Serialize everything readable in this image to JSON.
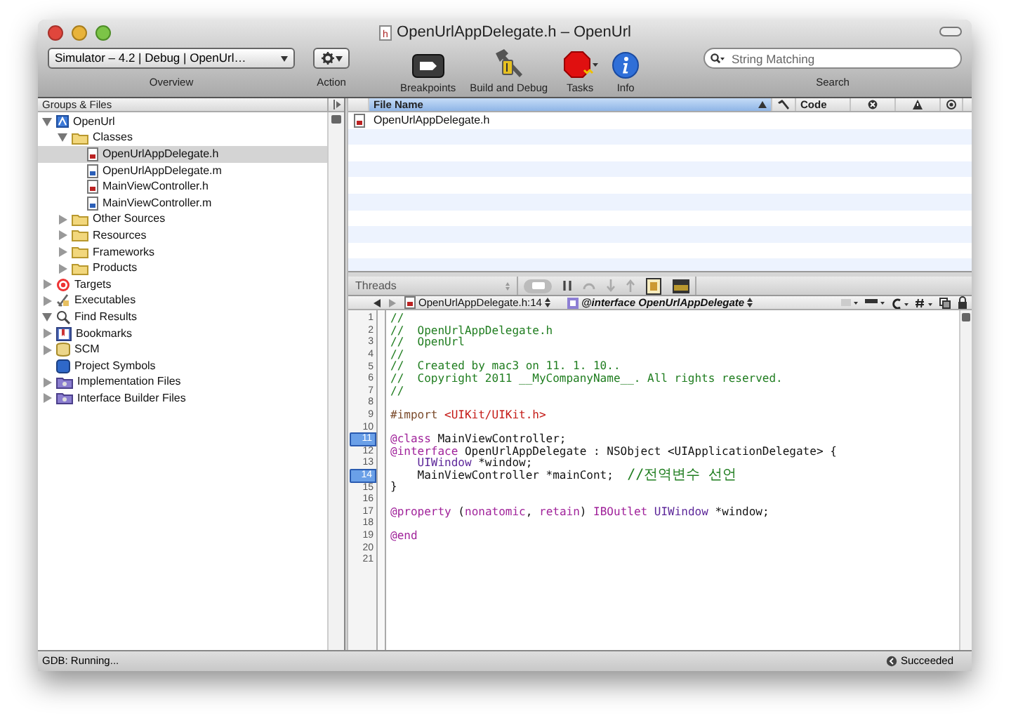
{
  "window": {
    "title": "OpenUrlAppDelegate.h – OpenUrl",
    "file_icon_letter": "h"
  },
  "toolbar": {
    "scheme": "Simulator – 4.2 | Debug | OpenUrl…",
    "scheme_label": "Overview",
    "action_label": "Action",
    "buttons": [
      {
        "kind": "breakpoints",
        "label": "Breakpoints"
      },
      {
        "kind": "build",
        "label": "Build and Debug"
      },
      {
        "kind": "tasks",
        "label": "Tasks"
      },
      {
        "kind": "info",
        "label": "Info"
      }
    ],
    "search": {
      "placeholder": "String Matching",
      "label": "Search"
    }
  },
  "sidebar": {
    "title": "Groups & Files",
    "items": [
      {
        "label": "OpenUrl",
        "kind": "project",
        "expanded": true,
        "selected": false,
        "children": [
          {
            "label": "Classes",
            "kind": "folder",
            "expanded": true,
            "selected": false,
            "children": [
              {
                "label": "OpenUrlAppDelegate.h",
                "kind": "file_h",
                "selected": true
              },
              {
                "label": "OpenUrlAppDelegate.m",
                "kind": "file_m",
                "selected": false
              },
              {
                "label": "MainViewController.h",
                "kind": "file_h",
                "selected": false
              },
              {
                "label": "MainViewController.m",
                "kind": "file_m",
                "selected": false
              }
            ]
          },
          {
            "label": "Other Sources",
            "kind": "folder",
            "expanded": false,
            "selected": false
          },
          {
            "label": "Resources",
            "kind": "folder",
            "expanded": false,
            "selected": false
          },
          {
            "label": "Frameworks",
            "kind": "folder",
            "expanded": false,
            "selected": false
          },
          {
            "label": "Products",
            "kind": "folder",
            "expanded": false,
            "selected": false
          }
        ]
      },
      {
        "label": "Targets",
        "kind": "target",
        "expanded": false,
        "selected": false
      },
      {
        "label": "Executables",
        "kind": "executables",
        "expanded": false,
        "selected": false
      },
      {
        "label": "Find Results",
        "kind": "find",
        "expanded": true,
        "selected": false
      },
      {
        "label": "Bookmarks",
        "kind": "bookmarks",
        "expanded": false,
        "selected": false
      },
      {
        "label": "SCM",
        "kind": "scm",
        "expanded": false,
        "selected": false
      },
      {
        "label": "Project Symbols",
        "kind": "symbols",
        "selected": false
      },
      {
        "label": "Implementation Files",
        "kind": "smartgroup",
        "expanded": false,
        "selected": false
      },
      {
        "label": "Interface Builder Files",
        "kind": "smartgroup",
        "expanded": false,
        "selected": false
      }
    ]
  },
  "file_table": {
    "columns": [
      {
        "kind": "text",
        "label": "File Name",
        "selected": true
      },
      {
        "kind": "hammer",
        "selected": false
      },
      {
        "kind": "text",
        "label": "Code",
        "selected": false
      },
      {
        "kind": "error",
        "selected": false
      },
      {
        "kind": "warning",
        "selected": false
      },
      {
        "kind": "target",
        "selected": false
      }
    ],
    "rows": [
      {
        "file_name": "OpenUrlAppDelegate.h"
      }
    ]
  },
  "debug_bar": {
    "threads": "Threads"
  },
  "navigation": {
    "file": "OpenUrlAppDelegate.h:14",
    "symbol": "@interface OpenUrlAppDelegate"
  },
  "editor": {
    "lines": [
      {
        "number": "1",
        "breakpoint": false,
        "code": [
          {
            "kind": "comment",
            "text": "//"
          }
        ]
      },
      {
        "number": "2",
        "breakpoint": false,
        "code": [
          {
            "kind": "comment",
            "text": "//  OpenUrlAppDelegate.h"
          }
        ]
      },
      {
        "number": "3",
        "breakpoint": false,
        "code": [
          {
            "kind": "comment",
            "text": "//  OpenUrl"
          }
        ]
      },
      {
        "number": "4",
        "breakpoint": false,
        "code": [
          {
            "kind": "comment",
            "text": "//"
          }
        ]
      },
      {
        "number": "5",
        "breakpoint": false,
        "code": [
          {
            "kind": "comment",
            "text": "//  Created by mac3 on 11. 1. 10.."
          }
        ]
      },
      {
        "number": "6",
        "breakpoint": false,
        "code": [
          {
            "kind": "comment",
            "text": "//  Copyright 2011 __MyCompanyName__. All rights reserved."
          }
        ]
      },
      {
        "number": "7",
        "breakpoint": false,
        "code": [
          {
            "kind": "comment",
            "text": "//"
          }
        ]
      },
      {
        "number": "8",
        "breakpoint": false
      },
      {
        "number": "9",
        "breakpoint": false,
        "code": [
          {
            "kind": "preprocessor",
            "text": "#import "
          },
          {
            "kind": "string",
            "text": "<UIKit/UIKit.h>"
          }
        ]
      },
      {
        "number": "10",
        "breakpoint": false
      },
      {
        "number": "11",
        "breakpoint": true,
        "code": [
          {
            "kind": "keyword",
            "text": "@class"
          },
          {
            "kind": "plain",
            "text": " MainViewController;"
          }
        ]
      },
      {
        "number": "12",
        "breakpoint": false,
        "code": [
          {
            "kind": "keyword",
            "text": "@interface"
          },
          {
            "kind": "plain",
            "text": " OpenUrlAppDelegate : NSObject <UIApplicationDelegate> {"
          }
        ]
      },
      {
        "number": "13",
        "breakpoint": false,
        "indent": true,
        "code": [
          {
            "kind": "type",
            "text": "UIWindow"
          },
          {
            "kind": "plain",
            "text": " *window;"
          }
        ]
      },
      {
        "number": "14",
        "breakpoint": true,
        "indent": true,
        "code": [
          {
            "kind": "plain",
            "text": "MainViewController *mainCont;  "
          },
          {
            "kind": "comment",
            "text": "//전역변수 선언"
          }
        ]
      },
      {
        "number": "15",
        "breakpoint": false,
        "code": [
          {
            "kind": "plain",
            "text": "}"
          }
        ]
      },
      {
        "number": "16",
        "breakpoint": false
      },
      {
        "number": "17",
        "breakpoint": false,
        "code": [
          {
            "kind": "keyword",
            "text": "@property"
          },
          {
            "kind": "plain",
            "text": " ("
          },
          {
            "kind": "keyword",
            "text": "nonatomic"
          },
          {
            "kind": "plain",
            "text": ", "
          },
          {
            "kind": "keyword",
            "text": "retain"
          },
          {
            "kind": "plain",
            "text": ") "
          },
          {
            "kind": "keyword",
            "text": "IBOutlet"
          },
          {
            "kind": "type",
            "text": " UIWindow"
          },
          {
            "kind": "plain",
            "text": " *window;"
          }
        ]
      },
      {
        "number": "18",
        "breakpoint": false
      },
      {
        "number": "19",
        "breakpoint": false,
        "code": [
          {
            "kind": "keyword",
            "text": "@end"
          }
        ]
      },
      {
        "number": "20",
        "breakpoint": false
      },
      {
        "number": "21",
        "breakpoint": false
      }
    ]
  },
  "status_bar": {
    "left": "GDB: Running...",
    "right": "Succeeded"
  }
}
